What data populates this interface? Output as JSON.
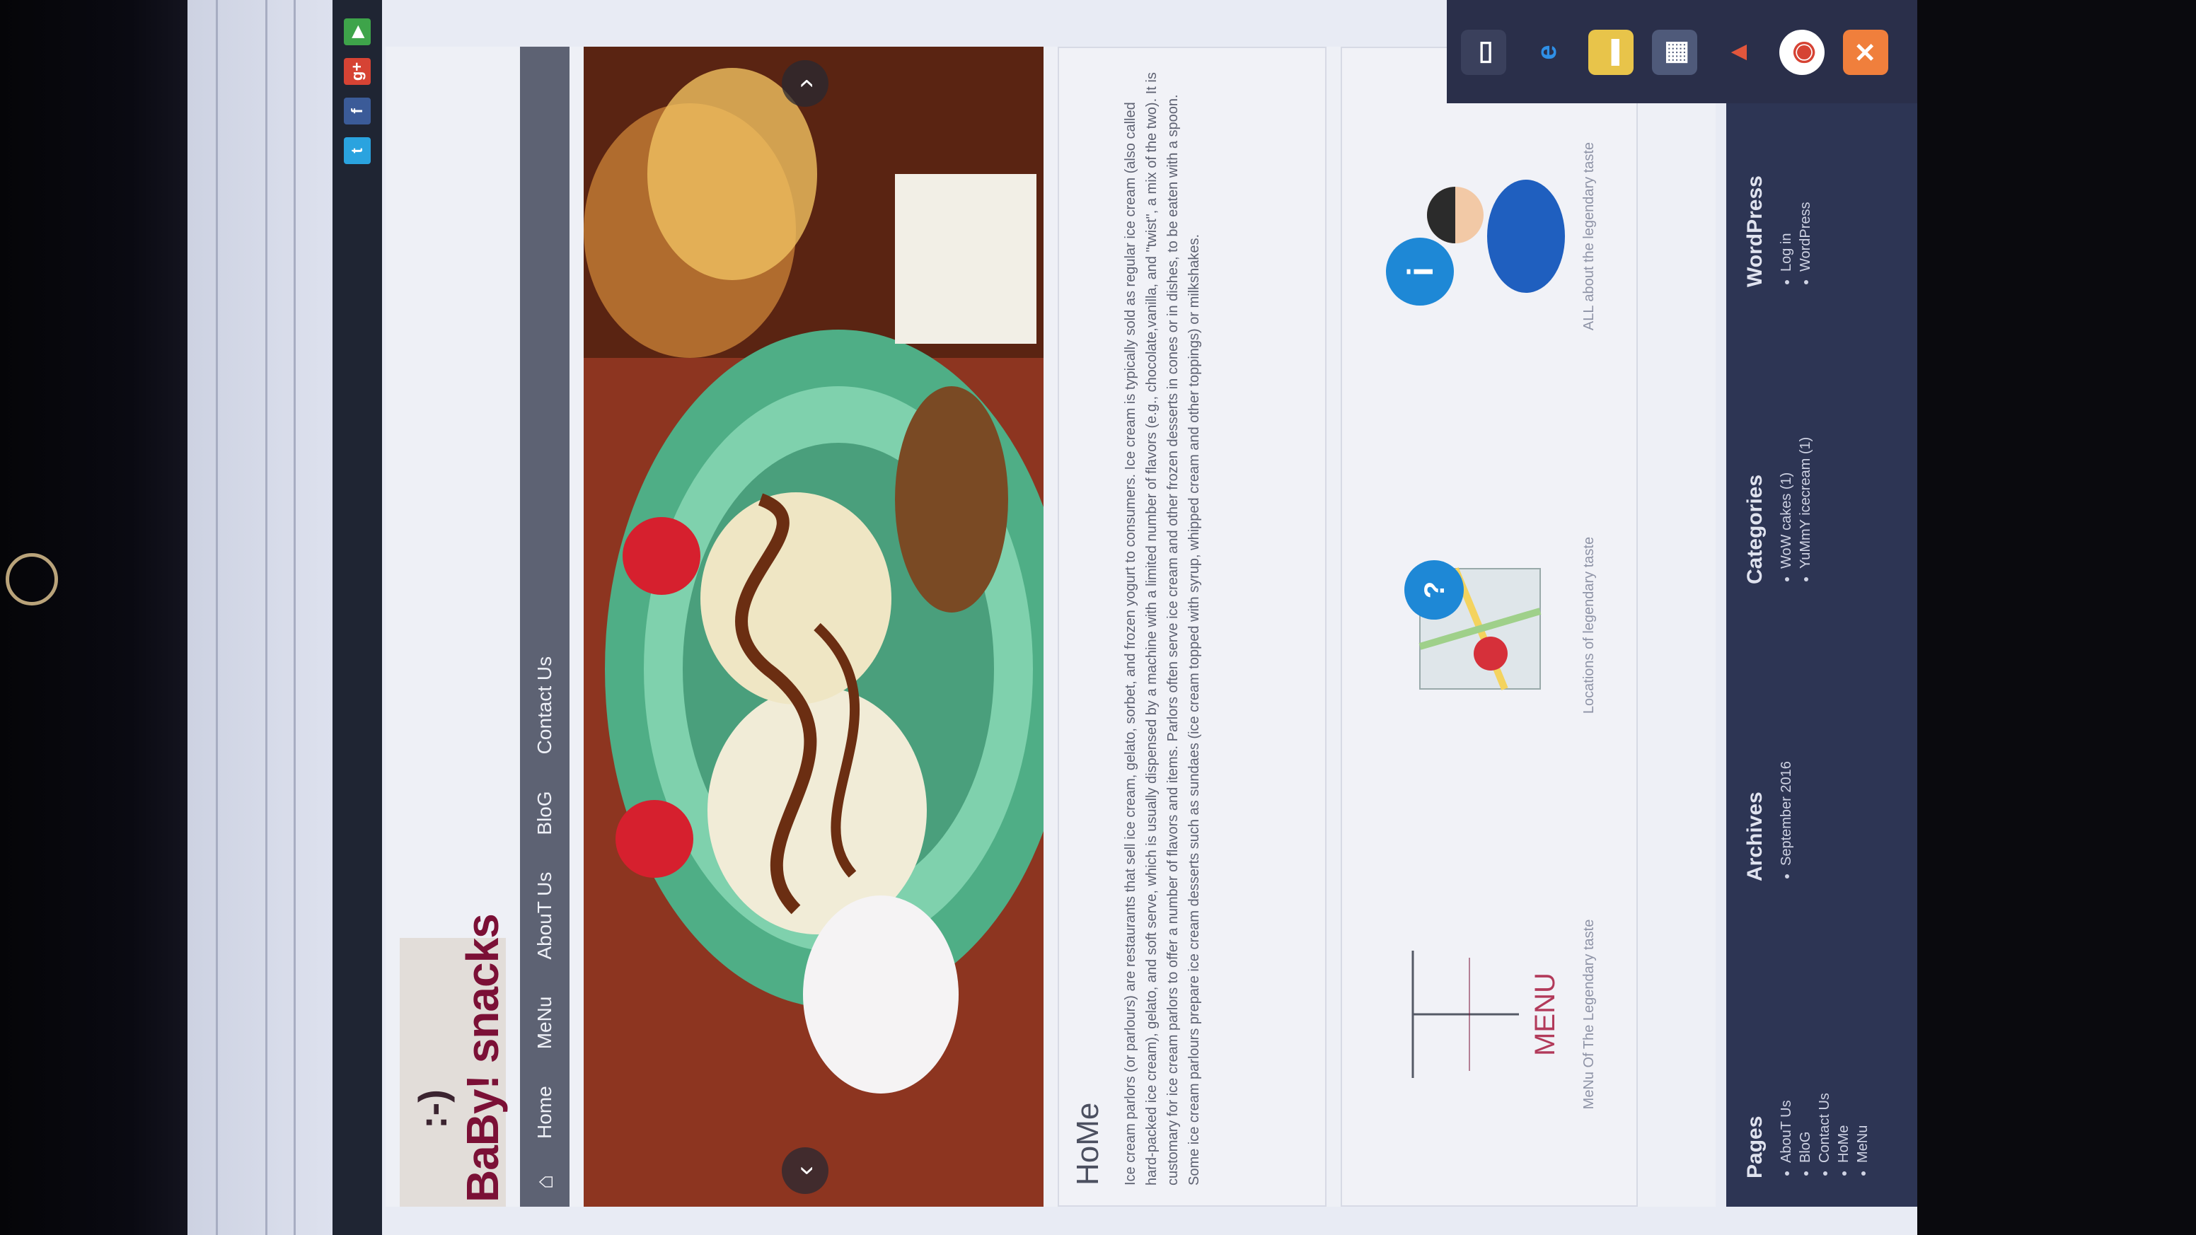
{
  "social": {
    "icons": [
      "twitter-icon",
      "facebook-icon",
      "google-plus-icon",
      "youtube-icon"
    ],
    "letters": [
      "t",
      "f",
      "g+",
      "▶"
    ]
  },
  "site": {
    "logo_text": "BaBy! snacks",
    "nav": {
      "items": [
        "Home",
        "MeNu",
        "AbouT Us",
        "BloG",
        "Contact Us"
      ]
    },
    "home": {
      "title": "HoMe",
      "body": "Ice cream parlors (or parlours) are restaurants that sell ice cream, gelato, sorbet, and frozen yogurt to consumers. Ice cream is typically sold as regular ice cream (also called hard-packed ice cream), gelato, and soft serve, which is usually dispensed by a machine with a limited number of flavors (e.g., chocolate,vanilla, and \"twist\", a mix of the two). It is customary for ice cream parlors to offer a number of flavors and items. Parlors often serve ice cream and other frozen desserts in cones or in dishes, to be eaten with a spoon. Some ice cream parlours prepare ice cream desserts such as sundaes (ice cream topped with syrup, whipped cream and other toppings) or milkshakes."
    },
    "features": [
      {
        "caption": "MeNu Of The Legendary taste",
        "graphic_label": "MENU"
      },
      {
        "caption": "Locations of legendary taste"
      },
      {
        "caption": "ALL about the legendary taste"
      }
    ],
    "footer": {
      "pages": {
        "title": "Pages",
        "items": [
          "AbouT Us",
          "BloG",
          "Contact Us",
          "HoMe",
          "MeNu"
        ]
      },
      "archives": {
        "title": "Archives",
        "items": [
          "September 2016"
        ]
      },
      "categories": {
        "title": "Categories",
        "items": [
          "WoW cakes (1)",
          "YuMmY icecream (1)"
        ]
      },
      "wordpress": {
        "title": "WordPress",
        "items": [
          "Log in",
          "WordPress"
        ]
      }
    }
  },
  "taskbar": {
    "icons": [
      "task-view-icon",
      "edge-icon",
      "file-explorer-icon",
      "store-icon",
      "app-icon",
      "chrome-icon",
      "xampp-icon"
    ]
  },
  "colors": {
    "nav_bg": "#5d6273",
    "logo_text": "#7b1036",
    "footer_bg": "#2d3554",
    "taskbar_bg": "#2a2f4a"
  }
}
